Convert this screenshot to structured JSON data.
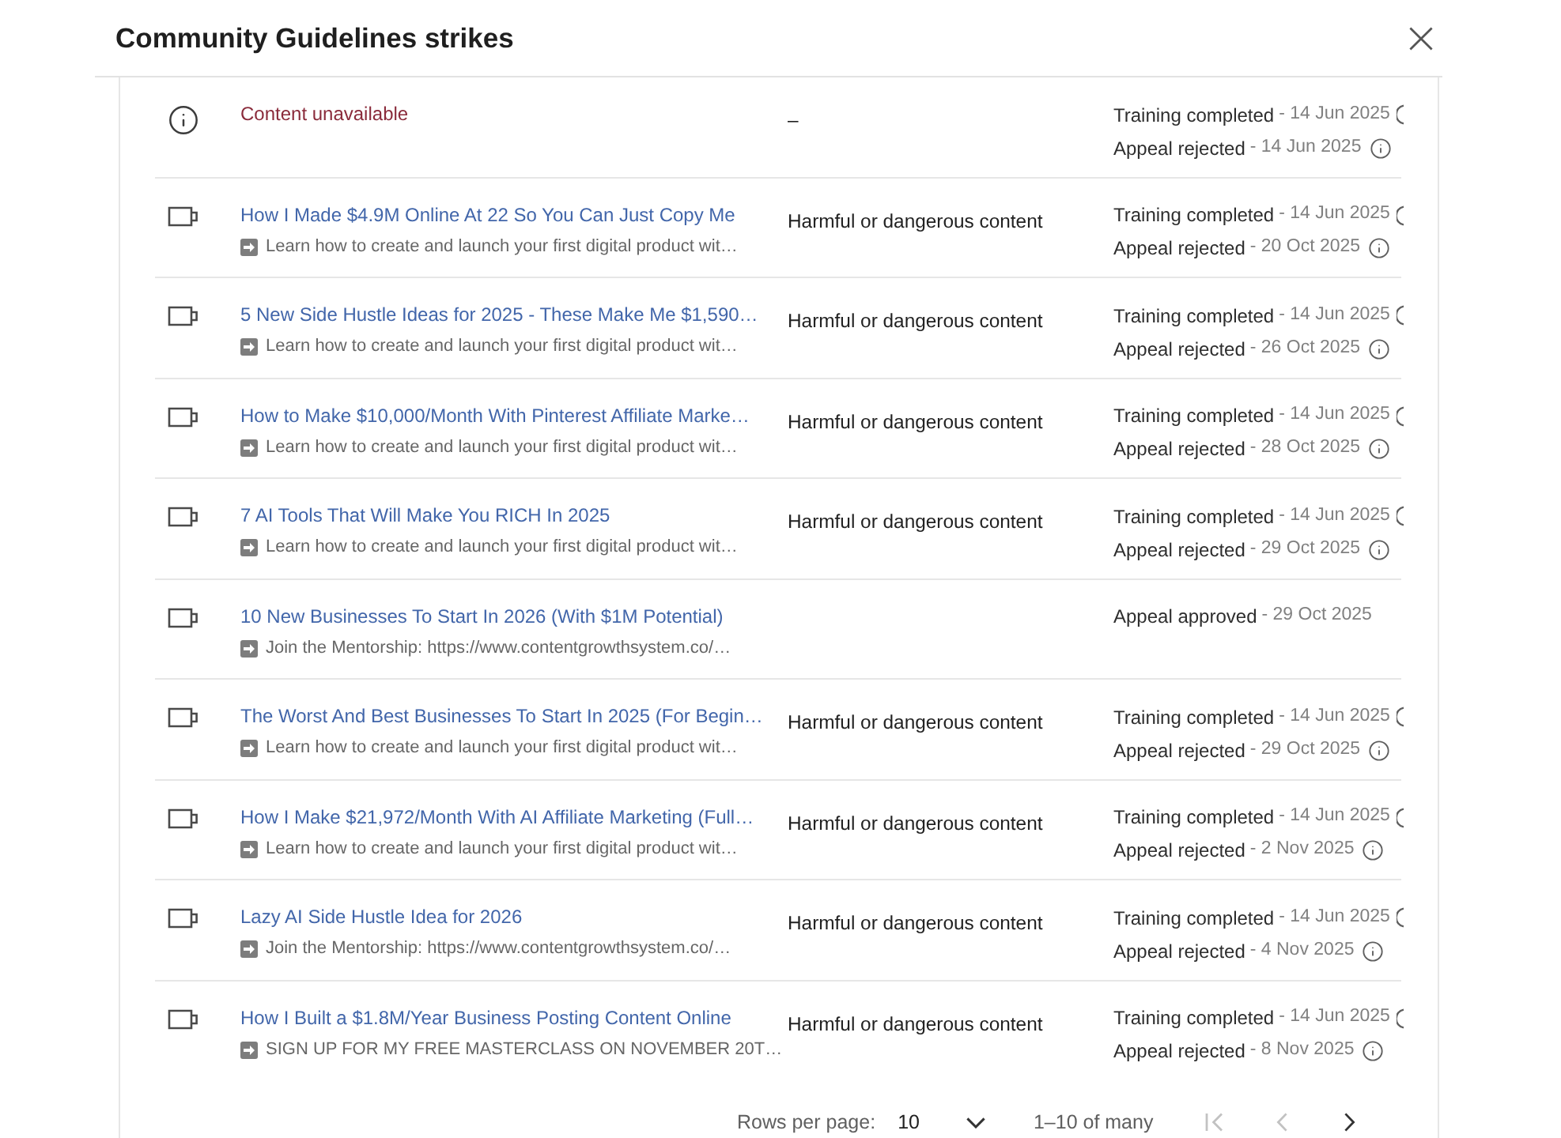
{
  "dialog": {
    "title": "Community Guidelines strikes"
  },
  "rows": [
    {
      "kind": "unavailable",
      "title": "Content unavailable",
      "policy": "–",
      "statuses": [
        {
          "label": "Training completed",
          "date": "- 14 Jun 2025",
          "info_icon": true,
          "cut_off": true
        },
        {
          "label": "Appeal rejected",
          "date": "- 14 Jun 2025",
          "info_icon": true,
          "cut_off": false
        }
      ]
    },
    {
      "kind": "video",
      "title": "How I Made $4.9M Online At 22 So You Can Just Copy Me",
      "description": "Learn how to create and launch your first digital product wit…",
      "policy": "Harmful or dangerous content",
      "statuses": [
        {
          "label": "Training completed",
          "date": "- 14 Jun 2025",
          "info_icon": true,
          "cut_off": true
        },
        {
          "label": "Appeal rejected",
          "date": "- 20 Oct 2025",
          "info_icon": true,
          "cut_off": false
        }
      ]
    },
    {
      "kind": "video",
      "title": "5 New Side Hustle Ideas for 2025 - These Make Me $1,590…",
      "description": "Learn how to create and launch your first digital product wit…",
      "policy": "Harmful or dangerous content",
      "statuses": [
        {
          "label": "Training completed",
          "date": "- 14 Jun 2025",
          "info_icon": true,
          "cut_off": true
        },
        {
          "label": "Appeal rejected",
          "date": "- 26 Oct 2025",
          "info_icon": true,
          "cut_off": false
        }
      ]
    },
    {
      "kind": "video",
      "title": "How to Make $10,000/Month With Pinterest Affiliate Marke…",
      "description": "Learn how to create and launch your first digital product wit…",
      "policy": "Harmful or dangerous content",
      "statuses": [
        {
          "label": "Training completed",
          "date": "- 14 Jun 2025",
          "info_icon": true,
          "cut_off": true
        },
        {
          "label": "Appeal rejected",
          "date": "- 28 Oct 2025",
          "info_icon": true,
          "cut_off": false
        }
      ]
    },
    {
      "kind": "video",
      "title": "7 AI Tools That Will Make You RICH In 2025",
      "description": "Learn how to create and launch your first digital product wit…",
      "policy": "Harmful or dangerous content",
      "statuses": [
        {
          "label": "Training completed",
          "date": "- 14 Jun 2025",
          "info_icon": true,
          "cut_off": true
        },
        {
          "label": "Appeal rejected",
          "date": "- 29 Oct 2025",
          "info_icon": true,
          "cut_off": false
        }
      ]
    },
    {
      "kind": "video",
      "title": "10 New Businesses To Start In 2026 (With $1M Potential)",
      "description": "Join the Mentorship: https://www.contentgrowthsystem.co/…",
      "statuses": [
        {
          "label": "Appeal approved",
          "date": "- 29 Oct 2025",
          "info_icon": false
        }
      ]
    },
    {
      "kind": "video",
      "title": "The Worst And Best Businesses To Start In 2025 (For Begin…",
      "description": "Learn how to create and launch your first digital product wit…",
      "policy": "Harmful or dangerous content",
      "statuses": [
        {
          "label": "Training completed",
          "date": "- 14 Jun 2025",
          "info_icon": true,
          "cut_off": true
        },
        {
          "label": "Appeal rejected",
          "date": "- 29 Oct 2025",
          "info_icon": true,
          "cut_off": false
        }
      ]
    },
    {
      "kind": "video",
      "title": "How I Make $21,972/Month With AI Affiliate Marketing (Full…",
      "description": "Learn how to create and launch your first digital product wit…",
      "policy": "Harmful or dangerous content",
      "statuses": [
        {
          "label": "Training completed",
          "date": "- 14 Jun 2025",
          "info_icon": true,
          "cut_off": true
        },
        {
          "label": "Appeal rejected",
          "date": "- 2 Nov 2025",
          "info_icon": true,
          "cut_off": false
        }
      ]
    },
    {
      "kind": "video",
      "title": "Lazy AI Side Hustle Idea for 2026",
      "description": "Join the Mentorship: https://www.contentgrowthsystem.co/…",
      "policy": "Harmful or dangerous content",
      "statuses": [
        {
          "label": "Training completed",
          "date": "- 14 Jun 2025",
          "info_icon": true,
          "cut_off": true
        },
        {
          "label": "Appeal rejected",
          "date": "- 4 Nov 2025",
          "info_icon": true,
          "cut_off": false
        }
      ]
    },
    {
      "kind": "video",
      "title": "How I Built a $1.8M/Year Business Posting Content Online",
      "description": "SIGN UP FOR MY FREE MASTERCLASS ON NOVEMBER 20T…",
      "policy": "Harmful or dangerous content",
      "statuses": [
        {
          "label": "Training completed",
          "date": "- 14 Jun 2025",
          "info_icon": true,
          "cut_off": true
        },
        {
          "label": "Appeal rejected",
          "date": "- 8 Nov 2025",
          "info_icon": true,
          "cut_off": false
        }
      ]
    }
  ],
  "pagination": {
    "rows_per_page_label": "Rows per page:",
    "rows_per_page": "10",
    "range": "1–10 of many",
    "buttons": [
      {
        "kind": "first",
        "disabled": true
      },
      {
        "kind": "previous",
        "disabled": true
      },
      {
        "kind": "next",
        "disabled": false
      }
    ]
  }
}
